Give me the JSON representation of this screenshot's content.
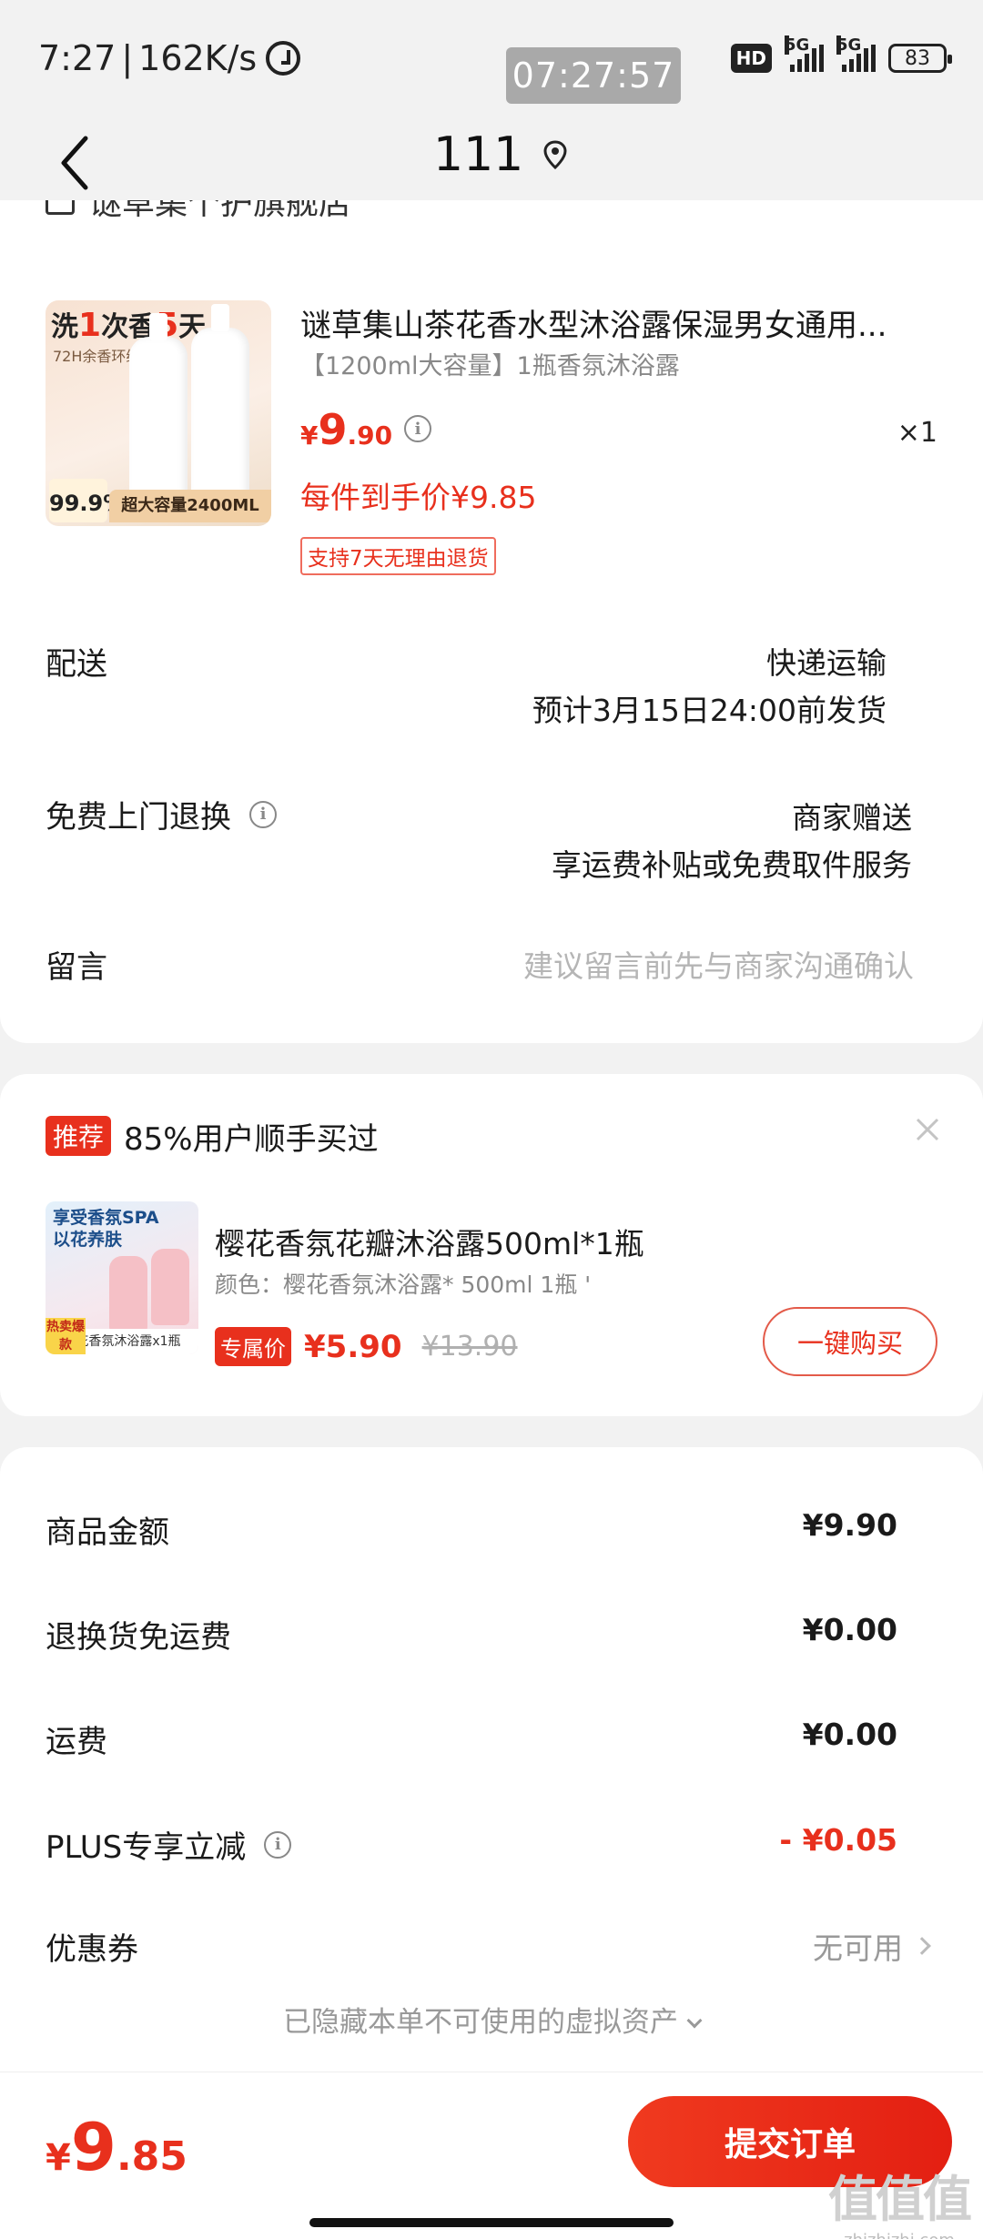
{
  "status_bar": {
    "time": "7:27",
    "speed": "162K/s",
    "clock_overlay": "07:27:57",
    "hd_badge": "HD",
    "network_1": "5G",
    "network_2": "5G",
    "battery": "83"
  },
  "header": {
    "title": "111",
    "back_icon": "chevron-left-icon",
    "location_icon": "location-pin-icon"
  },
  "shop": {
    "name": "谜草集个护旗舰店"
  },
  "product": {
    "image_top_text_a": "洗",
    "image_top_text_b": "1",
    "image_top_text_c": "次香",
    "image_top_text_d": "5",
    "image_top_text_e": "天",
    "image_sub_text": "72H余香环绕",
    "image_badge": "99.9%",
    "image_strip": "超大容量2400ML",
    "title": "谜草集山茶花香水型沐浴露保湿男女通用...",
    "spec": "【1200ml大容量】1瓶香氛沐浴露",
    "price_currency": "¥",
    "price_int": "9",
    "price_dec": ".90",
    "quantity": "×1",
    "each_price": "每件到手价¥9.85",
    "return_tag": "支持7天无理由退货"
  },
  "delivery": {
    "label": "配送",
    "method": "快递运输",
    "eta": "预计3月15日24:00前发货"
  },
  "return_service": {
    "label": "免费上门退换",
    "value": "商家赠送",
    "detail": "享运费补贴或免费取件服务"
  },
  "message": {
    "label": "留言",
    "placeholder": "建议留言前先与商家沟通确认"
  },
  "recommendation": {
    "tag": "推荐",
    "title": "85%用户顺手买过",
    "image_text_1": "享受香氛SPA",
    "image_text_2": "以花养肤",
    "image_hot": "热卖爆款",
    "image_strip": "樱花香氛沐浴露x1瓶",
    "name": "樱花香氛花瓣沐浴露500ml*1瓶",
    "spec": "颜色：樱花香氛沐浴露* 500ml 1瓶 '",
    "exclusive_tag": "专属价",
    "price": "¥5.90",
    "old_price": "¥13.90",
    "buy_label": "一键购买"
  },
  "summary": {
    "rows": [
      {
        "label": "商品金额",
        "value": "¥9.90"
      },
      {
        "label": "退换货免运费",
        "value": "¥0.00"
      },
      {
        "label": "运费",
        "value": "¥0.00"
      },
      {
        "label": "PLUS专享立减",
        "value": "- ¥0.05"
      }
    ],
    "coupon_label": "优惠券",
    "coupon_value": "无可用",
    "hidden_assets": "已隐藏本单不可使用的虚拟资产"
  },
  "bottom": {
    "total_currency": "¥",
    "total_int": "9",
    "total_dec": ".85",
    "submit_label": "提交订单"
  },
  "watermark": {
    "logo": "值值值",
    "site": "zhizhizhi.com"
  },
  "colors": {
    "accent": "#e8301d",
    "background": "#f2f2f2",
    "card": "#ffffff"
  }
}
